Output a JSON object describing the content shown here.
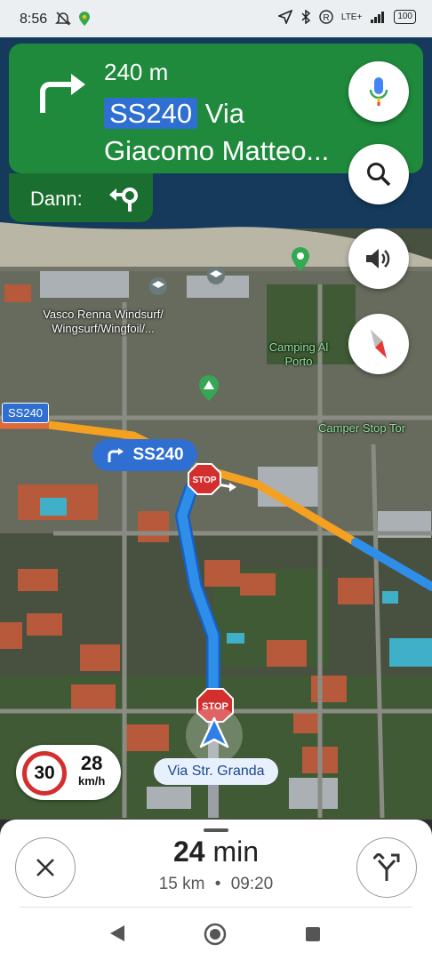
{
  "status_bar": {
    "time": "8:56",
    "network": "LTE+",
    "battery": "100"
  },
  "navigation": {
    "distance": "240 m",
    "road_shield": "SS240",
    "street_name": "Via Giacomo Matteo...",
    "then_label": "Dann:"
  },
  "map": {
    "turn_chip_label": "SS240",
    "shield_label": "SS240",
    "places": [
      "Vasco Renna Windsurf/ Wingsurf/Wingfoil/...",
      "Camping Al Porto",
      "Camper Stop Tor"
    ],
    "stop_sign": "STOP",
    "current_street": "Via Str. Granda"
  },
  "speed": {
    "limit": "30",
    "current": "28",
    "unit": "km/h"
  },
  "trip": {
    "duration_value": "24",
    "duration_unit": "min",
    "distance": "15 km",
    "separator": "•",
    "arrival": "09:20"
  },
  "icons": {
    "turn": "turn-right-icon",
    "then": "turn-left-roundabout-icon",
    "mic": "mic-icon",
    "search": "search-icon",
    "sound": "volume-icon",
    "compass": "compass-icon",
    "close": "close-icon",
    "routes": "alt-routes-icon"
  },
  "colors": {
    "nav_green": "#1f8a3c",
    "route_blue": "#2f8ee8",
    "traffic_orange": "#f4a020",
    "stop_red": "#d32f2f"
  }
}
